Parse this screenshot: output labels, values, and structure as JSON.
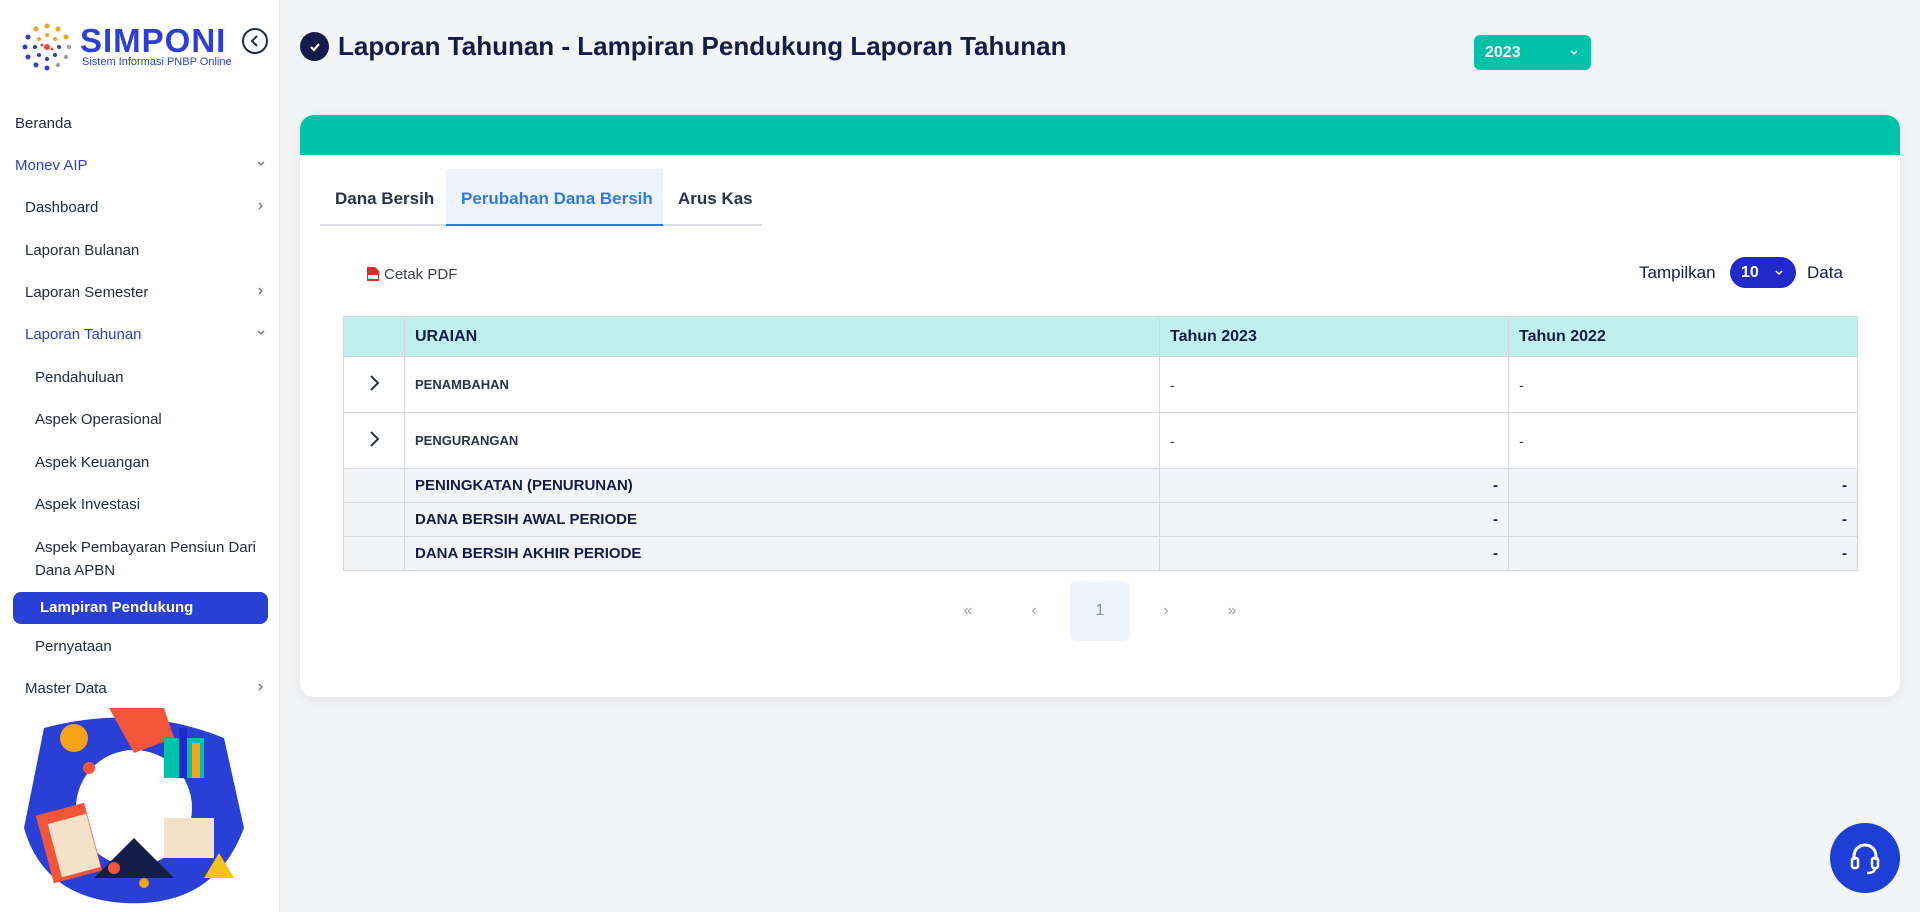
{
  "brand": {
    "name": "SIMPONI",
    "subtitle": "Sistem Informasi PNBP Online"
  },
  "sidebar": {
    "items": [
      {
        "label": "Beranda"
      },
      {
        "label": "Monev AIP"
      },
      {
        "label": "Dashboard"
      },
      {
        "label": "Laporan Bulanan"
      },
      {
        "label": "Laporan Semester"
      },
      {
        "label": "Laporan Tahunan"
      },
      {
        "label": "Pendahuluan"
      },
      {
        "label": "Aspek Operasional"
      },
      {
        "label": "Aspek Keuangan"
      },
      {
        "label": "Aspek Investasi"
      },
      {
        "label": "Aspek Pembayaran Pensiun Dari",
        "label2": "Dana APBN"
      },
      {
        "label": "Lampiran Pendukung"
      },
      {
        "label": "Pernyataan"
      },
      {
        "label": "Master Data"
      }
    ]
  },
  "header": {
    "title": "Laporan Tahunan - Lampiran Pendukung Laporan Tahunan",
    "year": "2023"
  },
  "tabs": [
    {
      "label": "Dana Bersih"
    },
    {
      "label": "Perubahan Dana Bersih"
    },
    {
      "label": "Arus Kas"
    }
  ],
  "toolbar": {
    "pdf_label": "Cetak PDF",
    "show_label": "Tampilkan",
    "page_size": "10",
    "data_label": "Data"
  },
  "table": {
    "headers": [
      "URAIAN",
      "Tahun 2023",
      "Tahun 2022"
    ],
    "rows": [
      {
        "label": "PENAMBAHAN",
        "y2023": "-",
        "y2022": "-"
      },
      {
        "label": "PENGURANGAN",
        "y2023": "-",
        "y2022": "-"
      }
    ],
    "summary": [
      {
        "label": "PENINGKATAN (PENURUNAN)",
        "y2023": "-",
        "y2022": "-"
      },
      {
        "label": "DANA BERSIH AWAL PERIODE",
        "y2023": "-",
        "y2022": "-"
      },
      {
        "label": "DANA BERSIH AKHIR PERIODE",
        "y2023": "-",
        "y2022": "-"
      }
    ]
  },
  "pagination": {
    "first": "«",
    "prev": "‹",
    "current": "1",
    "next": "›",
    "last": "»"
  },
  "colors": {
    "accent": "#2a3fd6",
    "teal": "#00c2a8",
    "header_bg": "#bff0ec"
  }
}
